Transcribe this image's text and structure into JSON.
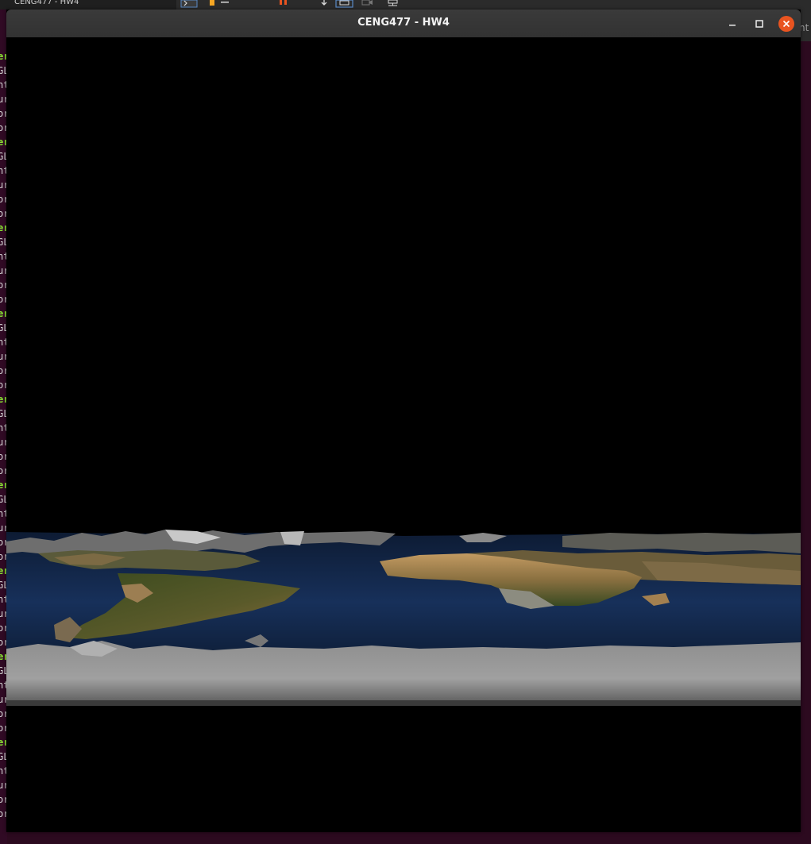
{
  "window": {
    "title": "CENG477 - HW4"
  },
  "taskbar": {
    "active_tab_label": "CENG477 - HW4",
    "icons": [
      "terminal-icon",
      "folder-icon",
      "pause-icon",
      "download-icon",
      "screenshot-icon",
      "record-icon",
      "network-icon"
    ]
  },
  "window_controls": [
    "minimize-icon",
    "maximize-icon",
    "close-icon"
  ],
  "background_terminal": {
    "line_fragments": [
      "er",
      "GL",
      "nt",
      "ur",
      "or",
      "or",
      "er",
      "GL",
      "nt",
      "ur",
      "or",
      "or",
      "er",
      "GL",
      "nt",
      "ur",
      "or",
      "or",
      "er",
      "GL",
      "nt",
      "ur",
      "or",
      "or",
      "er",
      "GL",
      "nt",
      "ur",
      "or",
      "or",
      "er",
      "GL",
      "nt",
      "ur",
      "or",
      "or",
      "er",
      "GL",
      "nt",
      "ur",
      "or",
      "or",
      "er",
      "GL",
      "nt",
      "ur",
      "or",
      "or",
      "er",
      "GL",
      "nt",
      "ur",
      "or",
      "or"
    ],
    "right_peek_text": "nt"
  },
  "render": {
    "scene": "heightmap-earth",
    "colors": {
      "background": "#000000",
      "ocean": "#13284a",
      "land": "#9c7a4c",
      "vegetation": "#3c4a22",
      "ice": "#9a9a9a",
      "accent_close": "#e95420"
    }
  }
}
